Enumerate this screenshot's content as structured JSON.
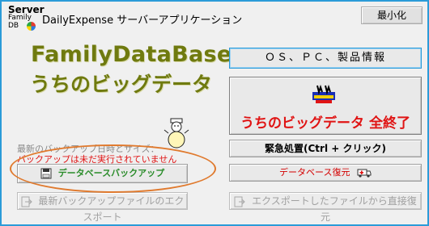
{
  "window": {
    "title": "DailyExpense サーバーアプリケーション",
    "icon_lines": [
      "Server",
      "Family",
      "DB"
    ],
    "minimize_label": "最小化"
  },
  "brand": {
    "title": "FamilyDataBase",
    "subtitle": "うちのビッグデータ",
    "color": "#6f7a0f"
  },
  "buttons": {
    "os_info": "ＯＳ、ＰＣ、製品情報",
    "shutdown": "うちのビッグデータ 全終了",
    "emergency": "緊急処置(Ctrl + クリック)",
    "db_restore": "データベース復元",
    "export_restore": "エクスポートしたファイルから直接復元",
    "db_backup": "データベースバックアップ",
    "export_latest": "最新バックアップファイルのエクスポート"
  },
  "backup": {
    "info_label": "最新のバックアップ日時とサイズ：",
    "status": "バックアップは未だ実行されていません"
  },
  "icons": {
    "app": "family-db-icon",
    "shutdown": "bigdata-exit-icon",
    "mascot": "snowman-icon",
    "restore": "ambulance-icon",
    "backup": "save-icon",
    "export": "export-icon",
    "import": "import-icon"
  },
  "colors": {
    "accent": "#2b9bd8",
    "danger": "#e01414",
    "success": "#2a8c2a",
    "highlight": "#e07a2e"
  }
}
